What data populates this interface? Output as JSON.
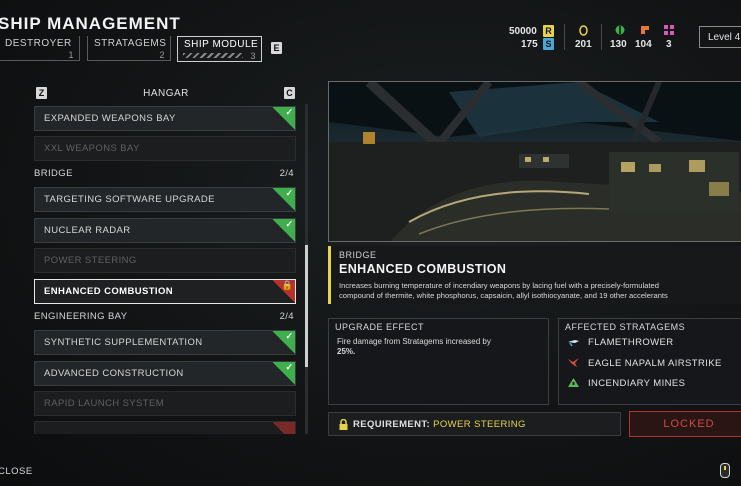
{
  "header": {
    "title": "SHIP MANAGEMENT",
    "tabs": [
      {
        "label": "DESTROYER",
        "num": "1"
      },
      {
        "label": "STRATAGEMS",
        "num": "2"
      },
      {
        "label": "SHIP MODULE",
        "num": "3"
      }
    ],
    "tab_next_key": "E",
    "resources": {
      "req_value": "50000",
      "req_icon": "R",
      "medals_value": "175",
      "medals_icon": "S",
      "credits_value": "201",
      "common_value": "130",
      "rare_value": "104",
      "super_value": "3"
    },
    "level_label": "Level 4"
  },
  "list": {
    "heading": "HANGAR",
    "prev_key": "Z",
    "next_key": "C",
    "rows": [
      {
        "label": "EXPANDED WEAPONS BAY",
        "state": "unlocked"
      },
      {
        "label": "XXL WEAPONS BAY",
        "state": "dim"
      },
      {
        "section": "BRIDGE",
        "count": "2/4"
      },
      {
        "label": "TARGETING SOFTWARE UPGRADE",
        "state": "unlocked"
      },
      {
        "label": "NUCLEAR RADAR",
        "state": "unlocked"
      },
      {
        "label": "POWER STEERING",
        "state": "dim"
      },
      {
        "label": "ENHANCED COMBUSTION",
        "state": "selected-locked"
      },
      {
        "section": "ENGINEERING BAY",
        "count": "2/4"
      },
      {
        "label": "SYNTHETIC SUPPLEMENTATION",
        "state": "unlocked"
      },
      {
        "label": "ADVANCED CONSTRUCTION",
        "state": "unlocked"
      },
      {
        "label": "RAPID LAUNCH SYSTEM",
        "state": "dim"
      }
    ]
  },
  "detail": {
    "category": "BRIDGE",
    "name": "ENHANCED COMBUSTION",
    "description_1": "Increases burning temperature of incendiary weapons by lacing fuel with a precisely-formulated",
    "description_2": "compound of thermite, white phosphorus, capsaicin, allyl isothiocyanate, and 19 other accelerants",
    "effect_heading": "UPGRADE EFFECT",
    "effect_text": "Fire damage from Stratagems increased by",
    "effect_value": "25%.",
    "affected_heading": "AFFECTED STRATAGEMS",
    "stratagems": [
      "FLAMETHROWER",
      "EAGLE NAPALM AIRSTRIKE",
      "INCENDIARY MINES"
    ],
    "requirement_label": "REQUIREMENT:",
    "requirement_value": "POWER STEERING",
    "locked_label": "LOCKED"
  },
  "footer": {
    "close_label": "CLOSE"
  },
  "colors": {
    "accent_yellow": "#e8d44a",
    "unlocked_green": "#3fae4c",
    "locked_red": "#b8322c"
  }
}
